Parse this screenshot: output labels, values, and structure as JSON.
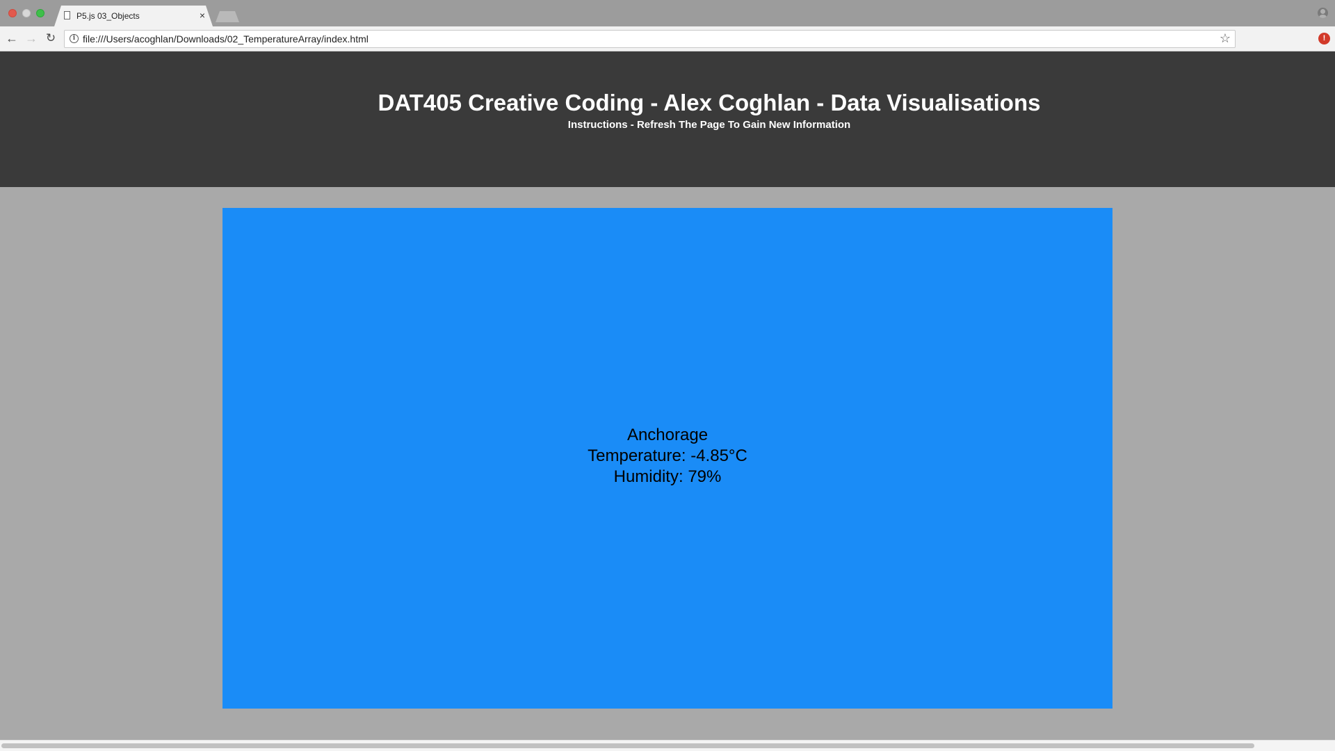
{
  "browser": {
    "tab": {
      "title": "P5.js 03_Objects",
      "close_glyph": "×"
    },
    "address_bar": {
      "url": "file:///Users/acoghlan/Downloads/02_TemperatureArray/index.html"
    },
    "icons": {
      "back": "←",
      "forward": "→",
      "reload": "↻",
      "info": "i",
      "star": "☆",
      "extension": "!"
    }
  },
  "page": {
    "title": "DAT405 Creative Coding - Alex Coghlan - Data Visualisations",
    "subtitle": "Instructions - Refresh The Page To Gain New Information"
  },
  "weather": {
    "city": "Anchorage",
    "temperature": "Temperature: -4.85°C",
    "humidity": "Humidity: 79%",
    "background_color": "#1a8cf7"
  },
  "colors": {
    "header_bg": "#3a3a3a",
    "page_bg": "#a9a9a9",
    "canvas_bg": "#1a8cf7"
  }
}
